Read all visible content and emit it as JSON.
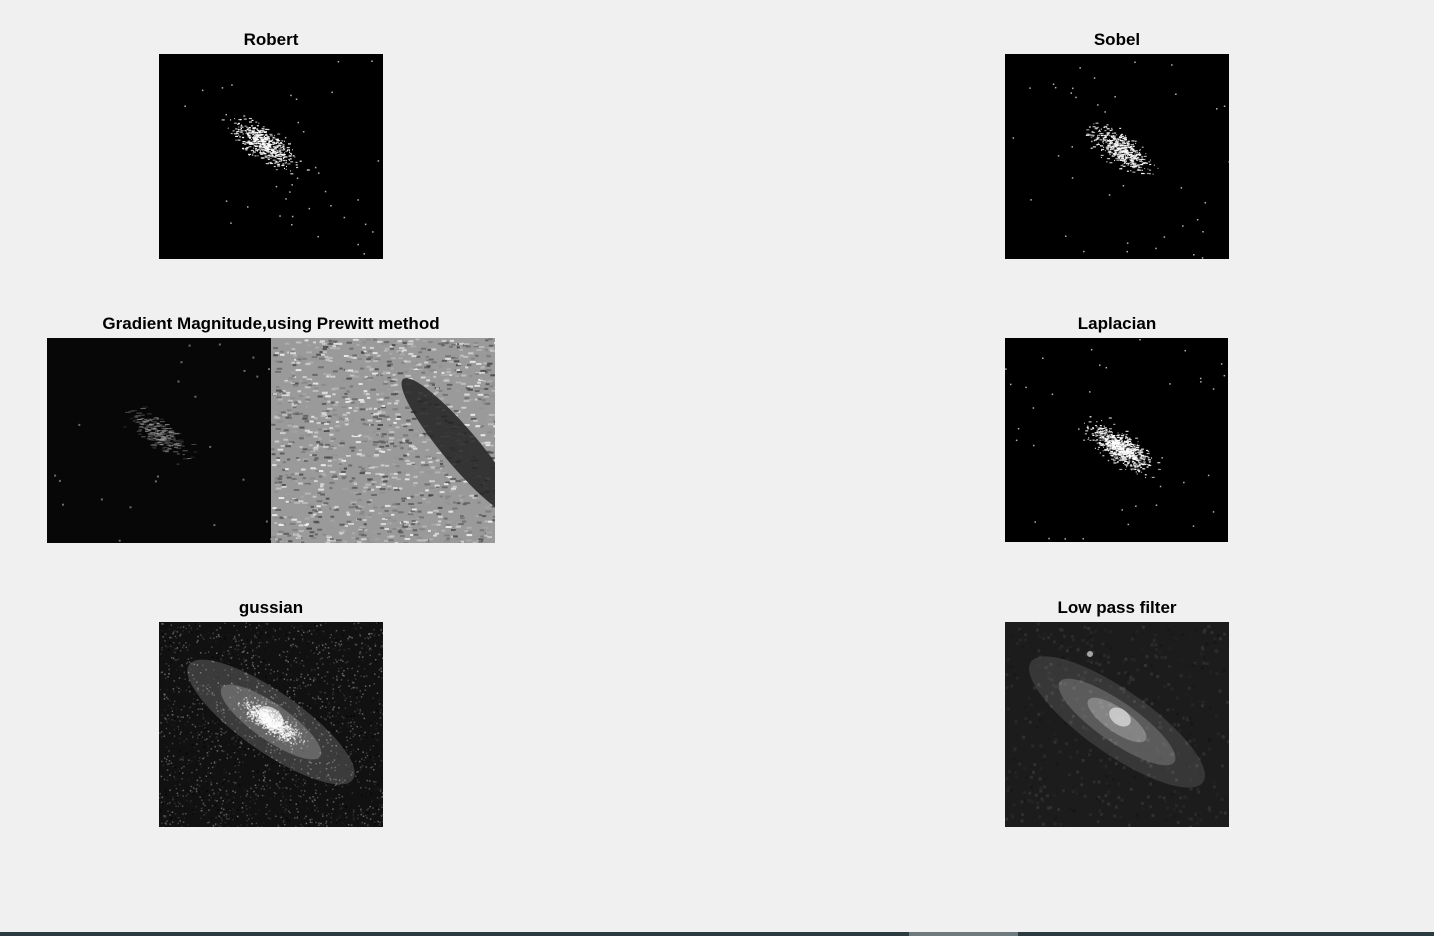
{
  "figure": {
    "panels": [
      {
        "id": "robert",
        "title": "Robert",
        "kind": "edge",
        "icon": "edge-map-image"
      },
      {
        "id": "sobel",
        "title": "Sobel",
        "kind": "edge",
        "icon": "edge-map-image"
      },
      {
        "id": "prewitt",
        "title": "Gradient Magnitude,using Prewitt method",
        "kind": "gradient",
        "icon": "gradient-montage-image"
      },
      {
        "id": "laplacian",
        "title": "Laplacian",
        "kind": "edge",
        "icon": "edge-map-image"
      },
      {
        "id": "gaussian",
        "title": "gussian",
        "kind": "noisy",
        "icon": "galaxy-image"
      },
      {
        "id": "lowpass",
        "title": "Low pass filter",
        "kind": "smooth",
        "icon": "galaxy-image"
      }
    ]
  },
  "colors": {
    "background": "#f0f0f0",
    "image_background": "#000000",
    "taskbar": "#2c3b40"
  }
}
